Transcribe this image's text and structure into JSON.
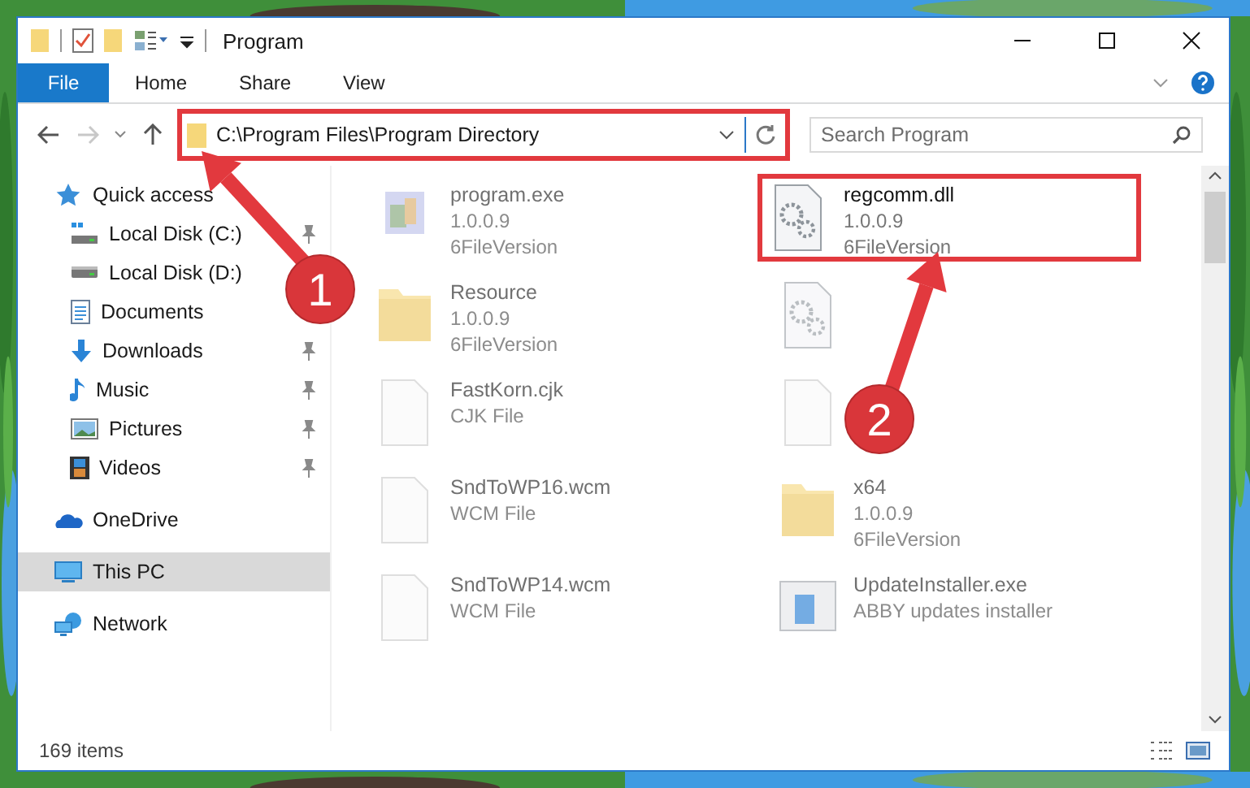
{
  "window": {
    "title": "Program"
  },
  "ribbon_tabs": [
    {
      "label": "File",
      "selected": true
    },
    {
      "label": "Home",
      "selected": false
    },
    {
      "label": "Share",
      "selected": false
    },
    {
      "label": "View",
      "selected": false
    }
  ],
  "address_bar": {
    "path": "C:\\Program Files\\Program Directory",
    "highlighted": true
  },
  "search": {
    "placeholder": "Search Program"
  },
  "sidebar": {
    "items": [
      {
        "label": "Quick access",
        "kind": "star",
        "selected": false,
        "children": [
          {
            "label": "Local Disk (C:)",
            "kind": "osdrive",
            "pinned": true,
            "selected": false
          },
          {
            "label": "Local Disk (D:)",
            "kind": "drive",
            "pinned": false,
            "selected": false
          },
          {
            "label": "Documents",
            "kind": "documents",
            "pinned": false,
            "selected": false
          },
          {
            "label": "Downloads",
            "kind": "downloads",
            "pinned": true,
            "selected": false
          },
          {
            "label": "Music",
            "kind": "music",
            "pinned": true,
            "selected": false
          },
          {
            "label": "Pictures",
            "kind": "pictures",
            "pinned": true,
            "selected": false
          },
          {
            "label": "Videos",
            "kind": "videos",
            "pinned": true,
            "selected": false
          }
        ]
      },
      {
        "label": "OneDrive",
        "kind": "cloud",
        "selected": false
      },
      {
        "label": "This PC",
        "kind": "pc",
        "selected": true
      },
      {
        "label": "Network",
        "kind": "network",
        "selected": false
      }
    ]
  },
  "files": [
    {
      "name": "program.exe",
      "kind": "exe",
      "details": [
        "1.0.0.9",
        "6FileVersion"
      ],
      "highlighted": false,
      "blurred": true
    },
    {
      "name": "regcomm.dll",
      "kind": "dll",
      "details": [
        "1.0.0.9",
        "6FileVersion"
      ],
      "highlighted": true,
      "blurred": false
    },
    {
      "name": "Resource",
      "kind": "folder",
      "details": [
        "1.0.0.9",
        "6FileVersion"
      ],
      "highlighted": false,
      "blurred": true
    },
    {
      "kind": "dll",
      "highlighted": false,
      "blurred": true
    },
    {
      "name": "FastKorn.cjk",
      "kind": "file",
      "details": [
        "CJK File"
      ],
      "highlighted": false,
      "blurred": true
    },
    {
      "kind": "file",
      "highlighted": false,
      "blurred": true
    },
    {
      "name": "SndToWP16.wcm",
      "kind": "file",
      "details": [
        "WCM File"
      ],
      "highlighted": false,
      "blurred": true
    },
    {
      "name": "x64",
      "kind": "folder",
      "details": [
        "1.0.0.9",
        "6FileVersion"
      ],
      "highlighted": false,
      "blurred": true
    },
    {
      "name": "SndToWP14.wcm",
      "kind": "file",
      "details": [
        "WCM File"
      ],
      "highlighted": false,
      "blurred": true
    },
    {
      "name": "UpdateInstaller.exe",
      "kind": "installer",
      "details": [
        "ABBY updates installer"
      ],
      "highlighted": false,
      "blurred": true
    }
  ],
  "annotations": [
    {
      "number": "1"
    },
    {
      "number": "2"
    }
  ],
  "status_bar": {
    "count": "169 items"
  }
}
